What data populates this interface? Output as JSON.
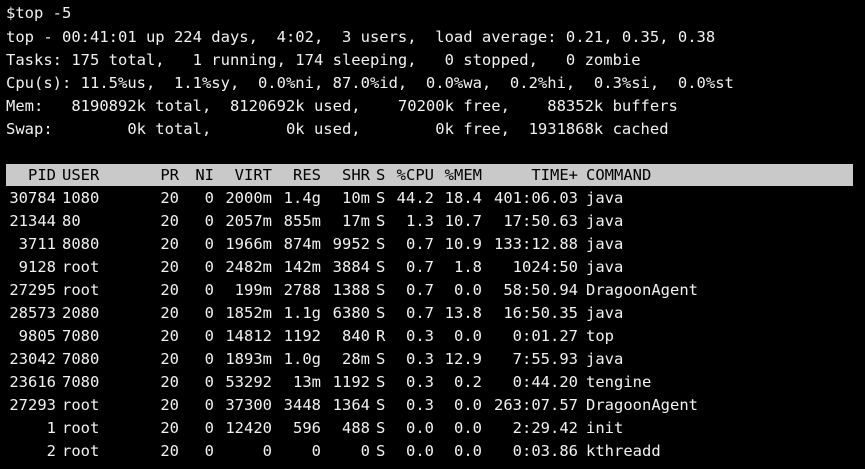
{
  "summary": {
    "command": "$top -5",
    "line1": "top - 00:41:01 up 224 days,  4:02,  3 users,  load average: 0.21, 0.35, 0.38",
    "line2": "Tasks: 175 total,   1 running, 174 sleeping,   0 stopped,   0 zombie",
    "line3": "Cpu(s): 11.5%us,  1.1%sy,  0.0%ni, 87.0%id,  0.0%wa,  0.2%hi,  0.3%si,  0.0%st",
    "line4": "Mem:   8190892k total,  8120692k used,    70200k free,    88352k buffers",
    "line5": "Swap:        0k total,        0k used,        0k free,  1931868k cached"
  },
  "table": {
    "columns": [
      "PID",
      "USER",
      "PR",
      "NI",
      "VIRT",
      "RES",
      "SHR",
      "S",
      "%CPU",
      "%MEM",
      "TIME+",
      "COMMAND"
    ],
    "rows": [
      [
        "30784",
        "1080",
        "20",
        "0",
        "2000m",
        "1.4g",
        "10m",
        "S",
        "44.2",
        "18.4",
        "401:06.03",
        "java"
      ],
      [
        "21344",
        "80",
        "20",
        "0",
        "2057m",
        "855m",
        "17m",
        "S",
        "1.3",
        "10.7",
        "17:50.63",
        "java"
      ],
      [
        "3711",
        "8080",
        "20",
        "0",
        "1966m",
        "874m",
        "9952",
        "S",
        "0.7",
        "10.9",
        "133:12.88",
        "java"
      ],
      [
        "9128",
        "root",
        "20",
        "0",
        "2482m",
        "142m",
        "3884",
        "S",
        "0.7",
        "1.8",
        "1024:50",
        "java"
      ],
      [
        "27295",
        "root",
        "20",
        "0",
        "199m",
        "2788",
        "1388",
        "S",
        "0.7",
        "0.0",
        "58:50.94",
        "DragoonAgent"
      ],
      [
        "28573",
        "2080",
        "20",
        "0",
        "1852m",
        "1.1g",
        "6380",
        "S",
        "0.7",
        "13.8",
        "16:50.35",
        "java"
      ],
      [
        "9805",
        "7080",
        "20",
        "0",
        "14812",
        "1192",
        "840",
        "R",
        "0.3",
        "0.0",
        "0:01.27",
        "top"
      ],
      [
        "23042",
        "7080",
        "20",
        "0",
        "1893m",
        "1.0g",
        "28m",
        "S",
        "0.3",
        "12.9",
        "7:55.93",
        "java"
      ],
      [
        "23616",
        "7080",
        "20",
        "0",
        "53292",
        "13m",
        "1192",
        "S",
        "0.3",
        "0.2",
        "0:44.20",
        "tengine"
      ],
      [
        "27293",
        "root",
        "20",
        "0",
        "37300",
        "3448",
        "1364",
        "S",
        "0.3",
        "0.0",
        "263:07.57",
        "DragoonAgent"
      ],
      [
        "1",
        "root",
        "20",
        "0",
        "12420",
        "596",
        "488",
        "S",
        "0.0",
        "0.0",
        "2:29.42",
        "init"
      ],
      [
        "2",
        "root",
        "20",
        "0",
        "0",
        "0",
        "0",
        "S",
        "0.0",
        "0.0",
        "0:03.86",
        "kthreadd"
      ]
    ]
  },
  "colors": {
    "background": "#000000",
    "text": "#f2f2f2",
    "header_bar": "#c9c9c9",
    "header_text": "#000000"
  }
}
